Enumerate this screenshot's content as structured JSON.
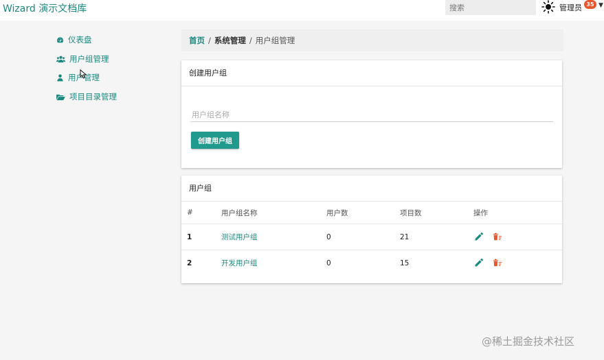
{
  "header": {
    "brand": "Wizard 演示文档库",
    "search_placeholder": "搜索",
    "user_name": "管理员",
    "notification_count": "35",
    "icons": {
      "theme": "sun-icon",
      "dropdown": "caret-down-icon"
    }
  },
  "sidebar": {
    "items": [
      {
        "label": "仪表盘",
        "icon": "dashboard-icon"
      },
      {
        "label": "用户组管理",
        "icon": "users-icon"
      },
      {
        "label": "用户管理",
        "icon": "user-icon"
      },
      {
        "label": "项目目录管理",
        "icon": "folder-open-icon"
      }
    ]
  },
  "breadcrumb": {
    "home": "首页",
    "section": "系统管理",
    "current": "用户组管理",
    "separator": "/"
  },
  "create_card": {
    "title": "创建用户组",
    "input_placeholder": "用户组名称",
    "input_value": "",
    "button_label": "创建用户组"
  },
  "groups_card": {
    "title": "用户组",
    "columns": [
      "#",
      "用户组名称",
      "用户数",
      "项目数",
      "操作"
    ],
    "rows": [
      {
        "index": "1",
        "name": "测试用户组",
        "users": "0",
        "projects": "21"
      },
      {
        "index": "2",
        "name": "开发用户组",
        "users": "0",
        "projects": "15"
      }
    ]
  },
  "watermark": "@稀土掘金技术社区",
  "colors": {
    "accent": "#1a8a80",
    "button": "#1f9a8c",
    "delete": "#e8572b",
    "badge": "#e8572b"
  }
}
